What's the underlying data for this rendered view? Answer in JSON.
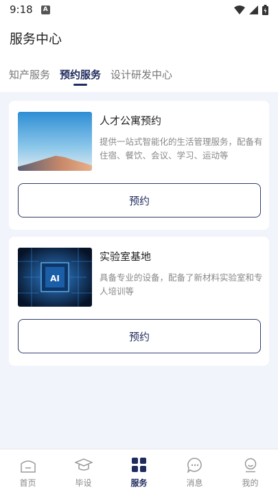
{
  "status_bar": {
    "time": "9:18",
    "notification_badge": "A"
  },
  "header": {
    "title": "服务中心"
  },
  "tabs": [
    {
      "label": "知产服务",
      "active": false
    },
    {
      "label": "预约服务",
      "active": true
    },
    {
      "label": "设计研发中心",
      "active": false
    }
  ],
  "services": [
    {
      "title": "人才公寓预约",
      "description": "提供一站式智能化的生活管理服务，配备有住宿、餐饮、会议、学习、运动等",
      "image_icon": "mountain-sky-image",
      "button_label": "预约"
    },
    {
      "title": "实验室基地",
      "description": "具备专业的设备，配备了新材料实验室和专人培训等",
      "image_icon": "ai-chip-image",
      "image_text": "AI",
      "button_label": "预约"
    }
  ],
  "bottom_nav": [
    {
      "label": "首页",
      "icon": "home-icon",
      "active": false
    },
    {
      "label": "毕设",
      "icon": "graduation-cap-icon",
      "active": false
    },
    {
      "label": "服务",
      "icon": "grid-icon",
      "active": true
    },
    {
      "label": "消息",
      "icon": "message-icon",
      "active": false
    },
    {
      "label": "我的",
      "icon": "user-icon",
      "active": false
    }
  ],
  "colors": {
    "accent": "#1f2b5c",
    "background": "#f1f4fb",
    "muted_text": "#888888"
  }
}
